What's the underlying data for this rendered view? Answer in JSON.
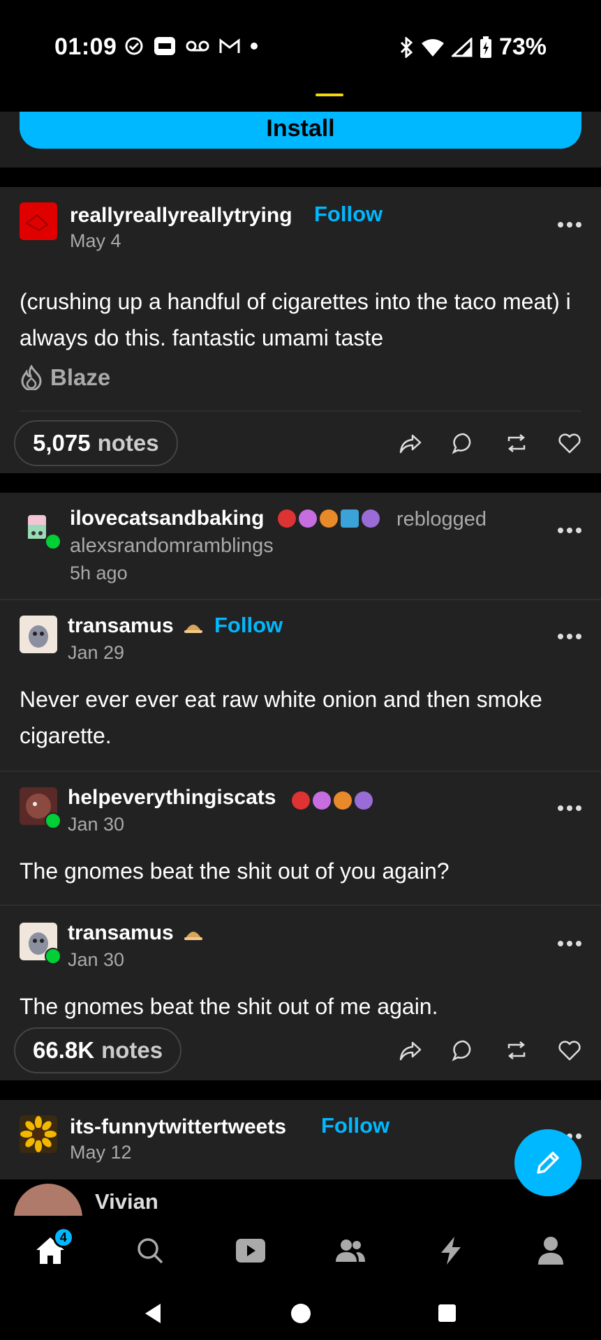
{
  "status_bar": {
    "time": "01:09",
    "battery": "73%",
    "icons": [
      "check-circle-icon",
      "app-icon",
      "voicemail-icon",
      "gmail-icon",
      "dot-icon",
      "bluetooth-icon",
      "wifi-icon",
      "signal-icon",
      "battery-icon"
    ]
  },
  "ad": {
    "install_label": "Install"
  },
  "post1": {
    "username": "reallyreallyreallytrying",
    "follow_label": "Follow",
    "date": "May 4",
    "text": "(crushing up a handful of cigarettes into the taco meat) i always do this. fantastic umami taste",
    "blaze_label": "Blaze",
    "notes_count": "5,075",
    "notes_label": "notes"
  },
  "post2": {
    "reblogger": "ilovecatsandbaking",
    "reblogged_label": "reblogged",
    "source": "alexsrandomramblings",
    "time_ago": "5h ago",
    "thread": [
      {
        "username": "transamus",
        "follow_label": "Follow",
        "date": "Jan 29",
        "text": "Never ever ever eat raw white onion and then smoke cigarette."
      },
      {
        "username": "helpeverythingiscats",
        "date": "Jan 30",
        "text": "The gnomes beat the shit out of you again?"
      },
      {
        "username": "transamus",
        "date": "Jan 30",
        "text": "The gnomes beat the shit out of me again."
      }
    ],
    "notes_count": "66.8K",
    "notes_label": "notes"
  },
  "post3": {
    "username": "its-funnytwittertweets",
    "follow_label": "Follow",
    "date": "May 12",
    "peek_name": "Vivian"
  },
  "nav": {
    "home_badge": "4",
    "items": [
      "home-icon",
      "search-icon",
      "video-icon",
      "community-icon",
      "activity-icon",
      "account-icon"
    ]
  },
  "colors": {
    "accent": "#00b8ff",
    "bg": "#222222",
    "reblog_green": "#00cf35"
  }
}
